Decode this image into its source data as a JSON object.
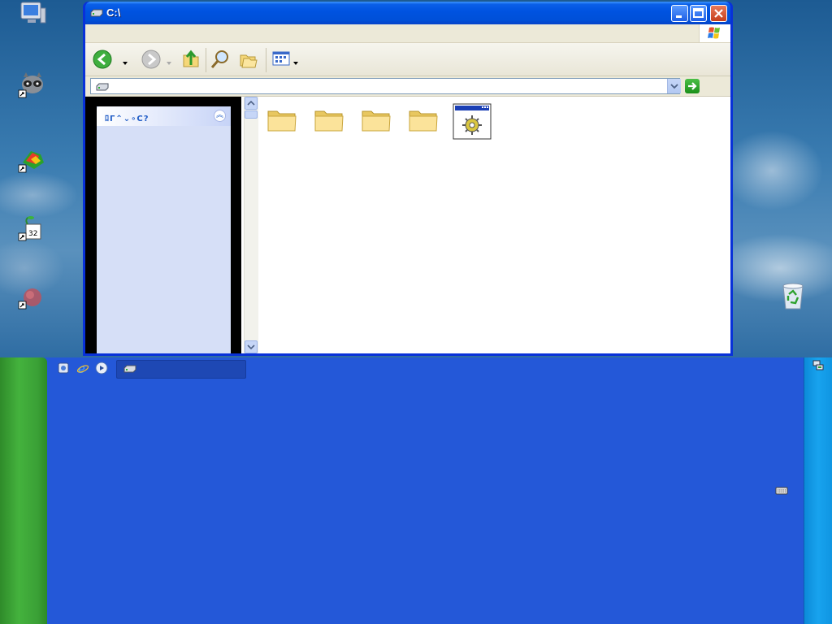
{
  "window": {
    "title": "C:\\",
    "address_value": "",
    "task_pane_title": "ﾛΓ⌃⌄∘C?"
  },
  "desktop": {
    "icons": [
      "computer-icon",
      "raccoon-shortcut-icon",
      "program-shortcut-icon",
      "plant-shortcut-icon",
      "red-ball-shortcut-icon",
      "recycle-bin-icon"
    ]
  },
  "files": [
    {
      "type": "folder",
      "label": ""
    },
    {
      "type": "folder",
      "label": ""
    },
    {
      "type": "folder",
      "label": ""
    },
    {
      "type": "folder",
      "label": ""
    },
    {
      "type": "application",
      "label": ""
    }
  ],
  "taskbar": {
    "active_task_label": "",
    "quick_launch": [
      "show-desktop-icon",
      "internet-explorer-icon",
      "media-player-icon"
    ]
  },
  "colors": {
    "title_blue": "#0053e1",
    "taskbar_blue": "#2458d8",
    "start_green": "#3aa036",
    "tray_blue": "#18a3ee"
  }
}
